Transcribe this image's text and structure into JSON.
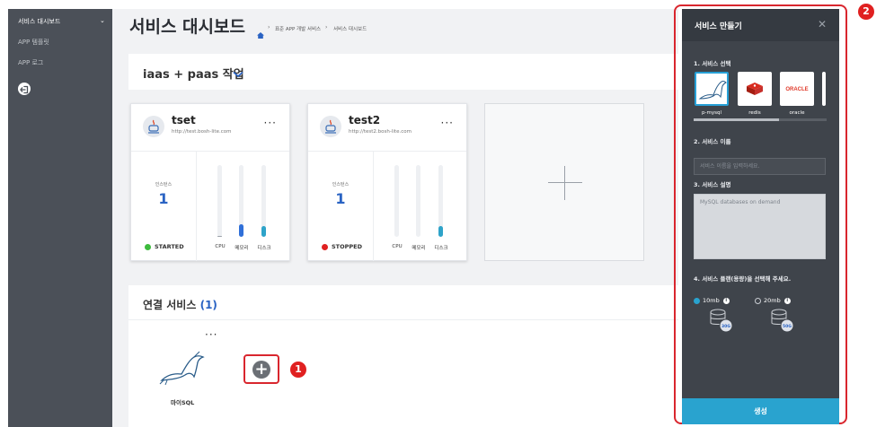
{
  "sidebar": {
    "items": [
      {
        "label": "서비스 대시보드"
      },
      {
        "label": "APP 템플릿"
      },
      {
        "label": "APP 로그"
      }
    ]
  },
  "header": {
    "title": "서비스 대시보드",
    "breadcrumb": [
      "표준 APP 개발 서비스",
      "서비스 대시보드"
    ]
  },
  "project": {
    "name": "iaas + paas 작업"
  },
  "apps": [
    {
      "name": "tset",
      "url": "http://test.bosh-lite.com",
      "instances_label": "인스턴스",
      "instances": "1",
      "status": "STARTED",
      "status_color": "#3dbb3d",
      "metrics": [
        {
          "label": "CPU",
          "fill": 0.0,
          "color": "#9aa0a8"
        },
        {
          "label": "메모리",
          "fill": 0.18,
          "color": "#2f6fd8"
        },
        {
          "label": "디스크",
          "fill": 0.15,
          "color": "#2ea3c9"
        }
      ]
    },
    {
      "name": "test2",
      "url": "http://test2.bosh-lite.com",
      "instances_label": "인스턴스",
      "instances": "1",
      "status": "STOPPED",
      "status_color": "#e02020",
      "metrics": [
        {
          "label": "CPU",
          "fill": 0.0,
          "color": "#9aa0a8"
        },
        {
          "label": "메모리",
          "fill": 0.0,
          "color": "#2f6fd8"
        },
        {
          "label": "디스크",
          "fill": 0.15,
          "color": "#2ea3c9"
        }
      ]
    }
  ],
  "connected": {
    "title": "연결 서비스",
    "count": "(1)",
    "items": [
      {
        "label": "마이SQL"
      }
    ]
  },
  "badges": {
    "one": "1",
    "two": "2"
  },
  "panel": {
    "title": "서비스 만들기",
    "sections": {
      "select": "1. 서비스 선택",
      "name": "2. 서비스 이름",
      "desc": "3. 서비스 설명",
      "plan": "4. 서비스 플랜(용량)을 선택해 주세요."
    },
    "services": [
      {
        "name": "p-mysql",
        "selected": true
      },
      {
        "name": "redis",
        "selected": false
      },
      {
        "name": "oracle",
        "selected": false
      }
    ],
    "name_placeholder": "서비스 이름을 입력하세요.",
    "desc_value": "MySQL databases on demand",
    "plans": [
      {
        "label": "10mb",
        "selected": true,
        "size": "30G"
      },
      {
        "label": "20mb",
        "selected": false,
        "size": "50G"
      }
    ],
    "create_label": "생성"
  }
}
